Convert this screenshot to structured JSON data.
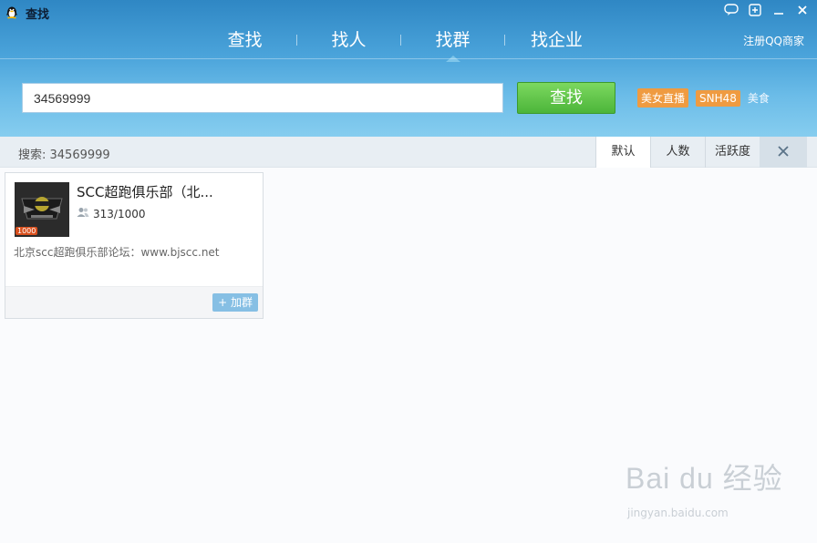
{
  "window": {
    "title": "查找",
    "buttons": [
      "chat-icon",
      "add-icon",
      "minimize-icon",
      "close-icon"
    ]
  },
  "nav": {
    "tabs": [
      {
        "label": "查找"
      },
      {
        "label": "找人"
      },
      {
        "label": "找群",
        "active": true
      },
      {
        "label": "找企业"
      }
    ],
    "register_link": "注册QQ商家"
  },
  "search": {
    "value": "34569999",
    "button_label": "查找",
    "tags": [
      "美女直播",
      "SNH48",
      "美食"
    ]
  },
  "filter": {
    "summary": "搜索: 34569999",
    "sort_tabs": [
      "默认",
      "人数",
      "活跃度"
    ],
    "active_sort": "默认"
  },
  "results": [
    {
      "name": "SCC超跑俱乐部（北...",
      "members": "313/1000",
      "level_badge": "1000",
      "description": "北京scc超跑俱乐部论坛：www.bjscc.net",
      "join_label": "加群"
    }
  ],
  "watermark": {
    "brand": "Bai du 经验",
    "url": "jingyan.baidu.com"
  },
  "colors": {
    "header_top": "#2f87c4",
    "header_bottom": "#86cdef",
    "search_button": "#4cb53a",
    "tag": "#ef9b41",
    "join_button": "#86bfe4"
  }
}
